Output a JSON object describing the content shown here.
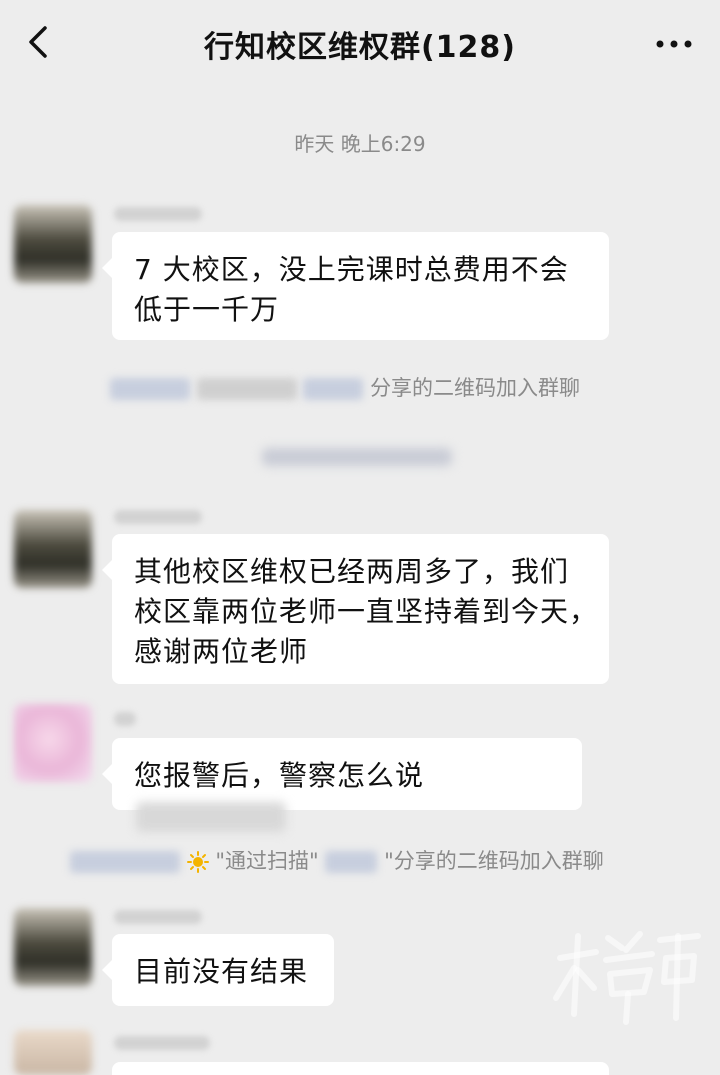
{
  "header": {
    "title": "行知校区维权群(128)"
  },
  "timestamp": "昨天 晚上6:29",
  "messages": [
    {
      "text": "7 大校区，没上完课时总费用不会\n低于一千万"
    },
    {
      "text": "其他校区维权已经两周多了，我们\n校区靠两位老师一直坚持着到今天，\n感谢两位老师"
    },
    {
      "text": "您报警后，警察怎么说"
    },
    {
      "text": "目前没有结果"
    }
  ],
  "system": {
    "join1_suffix": "分享的二维码加入群聊",
    "join2_prefix": "\"通过扫描\"",
    "join2_suffix": "\"分享的二维码加入群聊"
  },
  "icons": {
    "back": "chevron-left-icon",
    "more": "more-dots-icon",
    "sun": "sun-emoji-icon"
  },
  "colors": {
    "background": "#ededed",
    "bubble": "#ffffff",
    "system_text": "#8a8a8a"
  }
}
